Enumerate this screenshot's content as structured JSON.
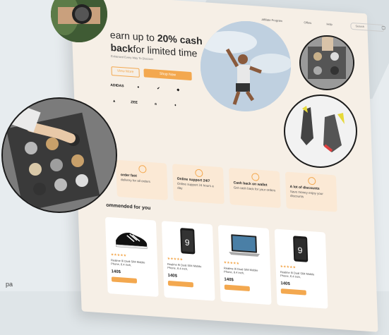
{
  "nav": {
    "links": [
      "Affiliate Program",
      "Offers",
      "Help"
    ],
    "search_placeholder": "Search"
  },
  "hero": {
    "title_a": "earn up to ",
    "title_b": "20% cash back",
    "title_c": "for limited time",
    "subtitle": "Enhanced Every Way To Discover",
    "btn_view": "View More",
    "btn_shop": "Shop Now"
  },
  "logos": [
    "ADIDAS",
    "",
    "",
    "",
    "",
    "ZEE",
    "",
    ""
  ],
  "features": [
    {
      "title": "order fast",
      "desc": "delivery for all orders"
    },
    {
      "title": "Online support 24/7",
      "desc": "Online support 24 hours a day"
    },
    {
      "title": "Cash back on wallet",
      "desc": "Get cash back for your orders"
    },
    {
      "title": "A lot of discounts",
      "desc": "Save money enjoy your discounts"
    }
  ],
  "recommended": "ommended for you",
  "products": [
    {
      "stars": "★★★★★",
      "name": "Realme 9i Dual SIM Mobile Phone, 6.4 inch,",
      "price": "140$"
    },
    {
      "stars": "★★★★★",
      "name": "Realme 9i Dual SIM Mobile Phone, 6.4 inch,",
      "price": "140$"
    },
    {
      "stars": "★★★★★",
      "name": "Realme 9i Dual SIM Mobile Phone, 6.4 inch,",
      "price": "140$"
    },
    {
      "stars": "★★★★★",
      "name": "Realme 9i Dual SIM Mobile Phone, 6.4 inch,",
      "price": "140$"
    }
  ],
  "caption": "pa",
  "colors": {
    "accent": "#f3a84f",
    "page_bg": "#f6efe6",
    "card_bg": "#fbe9d5"
  }
}
